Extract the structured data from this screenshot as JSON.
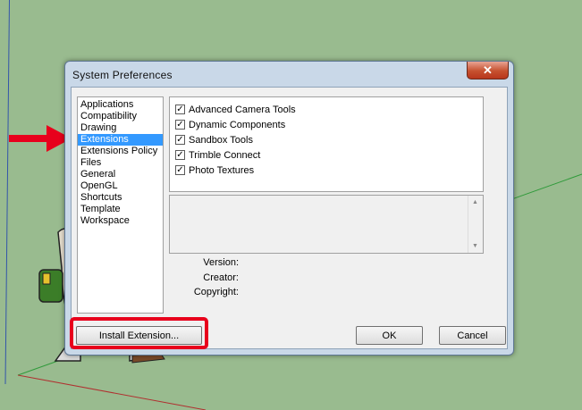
{
  "window": {
    "title": "System Preferences",
    "close_glyph": "✕"
  },
  "categories": [
    {
      "label": "Applications"
    },
    {
      "label": "Compatibility"
    },
    {
      "label": "Drawing"
    },
    {
      "label": "Extensions",
      "selected": true
    },
    {
      "label": "Extensions Policy"
    },
    {
      "label": "Files"
    },
    {
      "label": "General"
    },
    {
      "label": "OpenGL"
    },
    {
      "label": "Shortcuts"
    },
    {
      "label": "Template"
    },
    {
      "label": "Workspace"
    }
  ],
  "extensions": [
    {
      "label": "Advanced Camera Tools",
      "checked": true
    },
    {
      "label": "Dynamic Components",
      "checked": true
    },
    {
      "label": "Sandbox Tools",
      "checked": true
    },
    {
      "label": "Trimble Connect",
      "checked": true
    },
    {
      "label": "Photo Textures",
      "checked": true
    }
  ],
  "details": {
    "version_label": "Version:",
    "creator_label": "Creator:",
    "copyright_label": "Copyright:"
  },
  "buttons": {
    "install": "Install Extension...",
    "ok": "OK",
    "cancel": "Cancel"
  },
  "colors": {
    "selection": "#3399ff",
    "annotation_red": "#e8001c",
    "viewport_bg": "#99bb8f"
  },
  "icons": {
    "check": "✓",
    "scroll_up": "▲",
    "scroll_down": "▼"
  }
}
